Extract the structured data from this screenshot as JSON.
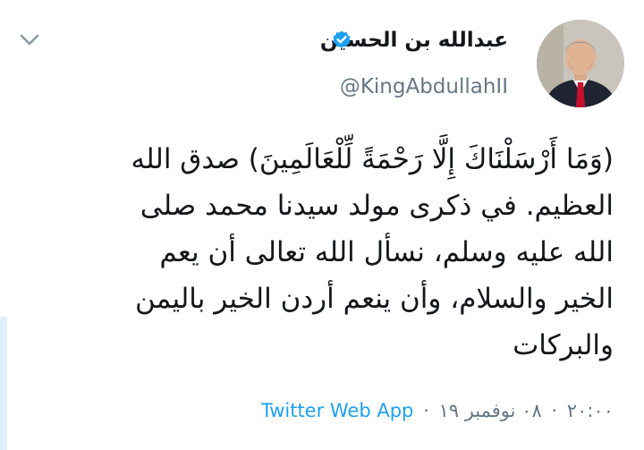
{
  "user": {
    "display_name": "عبدالله بن الحسين",
    "handle": "@KingAbdullahII",
    "verified": true,
    "avatar_icon": "profile-photo"
  },
  "tweet": {
    "line_1": "(وَمَا أَرْسَلْنَاكَ إِلَّا رَحْمَةً لِّلْعَالَمِينَ) صدق الله",
    "line_2": "العظيم. في ذكرى مولد سيدنا محمد صلى",
    "line_3": "الله عليه وسلم، نسأل الله تعالى أن يعم",
    "line_4": "الخير والسلام، وأن ينعم أردن الخير باليمن",
    "line_5": "والبركات"
  },
  "meta": {
    "time": "٢٠:٠٠",
    "separator_1": "·",
    "date": "٠٨ نوفمبر ١٩",
    "separator_2": "·",
    "source": "Twitter Web App"
  },
  "colors": {
    "text": "#14171a",
    "secondary": "#657786",
    "link": "#1da1f2",
    "verified": "#1da1f2"
  },
  "icons": {
    "verified": "verified-badge-icon",
    "menu": "chevron-down-icon"
  }
}
